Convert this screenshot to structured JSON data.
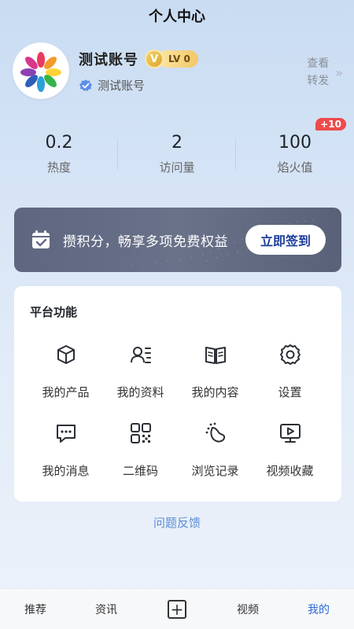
{
  "header": {
    "title": "个人中心"
  },
  "profile": {
    "name": "测试账号",
    "level_badge": "V",
    "level_label": "LV 0",
    "verified_text": "测试账号",
    "view_forward_line1": "查看",
    "view_forward_line2": "转发",
    "chevron": "»"
  },
  "stats": [
    {
      "value": "0.2",
      "label": "热度"
    },
    {
      "value": "2",
      "label": "访问量"
    },
    {
      "value": "100",
      "label": "焰火值",
      "badge": "+10"
    }
  ],
  "signin": {
    "text": "攒积分，畅享多项免费权益",
    "button": "立即签到"
  },
  "platform": {
    "title": "平台功能",
    "items": [
      {
        "label": "我的产品",
        "icon": "product-box-icon"
      },
      {
        "label": "我的资料",
        "icon": "profile-card-icon"
      },
      {
        "label": "我的内容",
        "icon": "book-icon"
      },
      {
        "label": "设置",
        "icon": "gear-icon"
      },
      {
        "label": "我的消息",
        "icon": "message-icon"
      },
      {
        "label": "二维码",
        "icon": "qr-code-icon"
      },
      {
        "label": "浏览记录",
        "icon": "history-icon"
      },
      {
        "label": "视频收藏",
        "icon": "video-collect-icon"
      }
    ]
  },
  "feedback": "问题反馈",
  "tabbar": {
    "items": [
      {
        "label": "推荐"
      },
      {
        "label": "资讯"
      },
      {
        "label": "+"
      },
      {
        "label": "视频"
      },
      {
        "label": "我的"
      }
    ]
  },
  "colors": {
    "accent": "#2f6bd9",
    "badge_red": "#ee4b4b",
    "signin_bg": "#626a82",
    "gold": "#f2c766"
  }
}
